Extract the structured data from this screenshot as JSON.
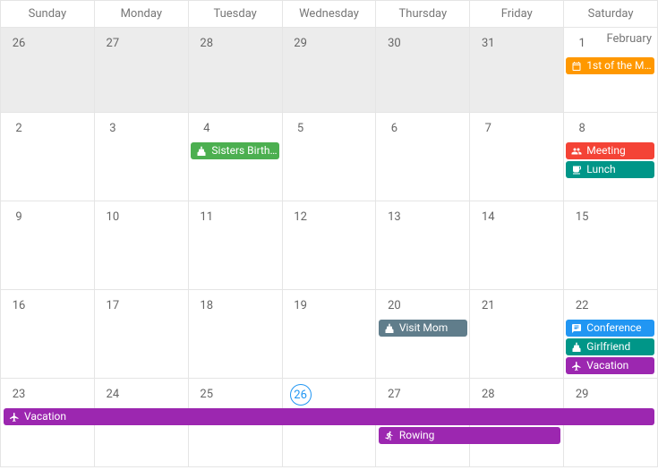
{
  "month_label": "February",
  "days_of_week": [
    "Sunday",
    "Monday",
    "Tuesday",
    "Wednesday",
    "Thursday",
    "Friday",
    "Saturday"
  ],
  "weeks": [
    {
      "days": [
        {
          "n": 26,
          "other": true
        },
        {
          "n": 27,
          "other": true
        },
        {
          "n": 28,
          "other": true
        },
        {
          "n": 29,
          "other": true
        },
        {
          "n": 30,
          "other": true
        },
        {
          "n": 31,
          "other": true
        },
        {
          "n": 1,
          "other": false
        }
      ]
    },
    {
      "days": [
        {
          "n": 2
        },
        {
          "n": 3
        },
        {
          "n": 4
        },
        {
          "n": 5
        },
        {
          "n": 6
        },
        {
          "n": 7
        },
        {
          "n": 8
        }
      ]
    },
    {
      "days": [
        {
          "n": 9
        },
        {
          "n": 10
        },
        {
          "n": 11
        },
        {
          "n": 12
        },
        {
          "n": 13
        },
        {
          "n": 14
        },
        {
          "n": 15
        }
      ]
    },
    {
      "days": [
        {
          "n": 16
        },
        {
          "n": 17
        },
        {
          "n": 18
        },
        {
          "n": 19
        },
        {
          "n": 20
        },
        {
          "n": 21
        },
        {
          "n": 22
        }
      ]
    },
    {
      "days": [
        {
          "n": 23
        },
        {
          "n": 24
        },
        {
          "n": 25
        },
        {
          "n": 26,
          "today": true
        },
        {
          "n": 27
        },
        {
          "n": 28
        },
        {
          "n": 29
        }
      ]
    }
  ],
  "events": [
    {
      "title": "1st of the M…",
      "week": 0,
      "row": 0,
      "start": 6,
      "span": 1,
      "color": "c-orange",
      "icon": "calendar",
      "name": "event-first-of-month"
    },
    {
      "title": "Sisters Birth…",
      "week": 1,
      "row": 0,
      "start": 2,
      "span": 1,
      "color": "c-green",
      "icon": "cake",
      "name": "event-sisters-birthday"
    },
    {
      "title": "Meeting",
      "week": 1,
      "row": 0,
      "start": 6,
      "span": 1,
      "color": "c-red",
      "icon": "people",
      "name": "event-meeting"
    },
    {
      "title": "Lunch",
      "week": 1,
      "row": 1,
      "start": 6,
      "span": 1,
      "color": "c-teal",
      "icon": "cup",
      "name": "event-lunch"
    },
    {
      "title": "Visit Mom",
      "week": 3,
      "row": 0,
      "start": 4,
      "span": 1,
      "color": "c-grey",
      "icon": "cake",
      "name": "event-visit-mom"
    },
    {
      "title": "Conference",
      "week": 3,
      "row": 0,
      "start": 6,
      "span": 1,
      "color": "c-blue",
      "icon": "chat",
      "name": "event-conference"
    },
    {
      "title": "Girlfriend",
      "week": 3,
      "row": 1,
      "start": 6,
      "span": 1,
      "color": "c-teal",
      "icon": "cake",
      "name": "event-girlfriend"
    },
    {
      "title": "Vacation",
      "week": 3,
      "row": 2,
      "start": 6,
      "span": 1,
      "color": "c-purple",
      "icon": "plane",
      "name": "event-vacation-1"
    },
    {
      "title": "Vacation",
      "week": 4,
      "row": 0,
      "start": 0,
      "span": 7,
      "color": "c-purple",
      "icon": "plane",
      "name": "event-vacation-2"
    },
    {
      "title": "Rowing",
      "week": 4,
      "row": 1,
      "start": 4,
      "span": 2,
      "color": "c-purple",
      "icon": "run",
      "name": "event-rowing"
    }
  ],
  "colors": {
    "orange": "#ff9800",
    "green": "#4caf50",
    "red": "#f44336",
    "teal": "#009688",
    "grey": "#607d8b",
    "blue": "#2196f3",
    "purple": "#9c27b0"
  }
}
